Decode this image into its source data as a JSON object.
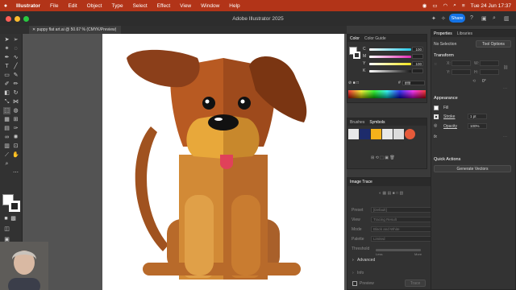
{
  "menubar": {
    "app_name": "Illustrator",
    "items": [
      "File",
      "Edit",
      "Object",
      "Type",
      "Select",
      "Effect",
      "View",
      "Window",
      "Help"
    ],
    "datetime": "Tue 24 Jun  17:37"
  },
  "window": {
    "title": "Adobe Illustrator 2025",
    "share_label": "Share"
  },
  "document_tab": {
    "label": "puppy flat art.ai @ 50.67 % (CMYK/Preview)"
  },
  "color_panel": {
    "tabs": [
      "Color",
      "Color Guide"
    ],
    "channels": [
      {
        "label": "C",
        "value": "100",
        "color": "#27c9e8"
      },
      {
        "label": "M",
        "value": "",
        "color": "#e32bb3"
      },
      {
        "label": "Y",
        "value": "100",
        "color": "#f1e51d"
      },
      {
        "label": "K",
        "value": "",
        "color": "#1a1a1a"
      }
    ],
    "hex": "ffffff"
  },
  "brushes_panel": {
    "tabs": [
      "Brushes",
      "Symbols"
    ]
  },
  "image_trace_panel": {
    "title": "Image Trace",
    "fields": [
      {
        "label": "Preset",
        "value": "[Default]"
      },
      {
        "label": "View",
        "value": "Tracing Result"
      },
      {
        "label": "Mode",
        "value": "Black and White"
      },
      {
        "label": "Palette",
        "value": "Limited"
      }
    ],
    "threshold_label": "Threshold",
    "threshold_less": "Less",
    "threshold_more": "More",
    "advanced_label": "Advanced",
    "info_label": "Info",
    "preview_label": "Preview",
    "trace_button": "Trace"
  },
  "properties_panel": {
    "tabs": [
      "Properties",
      "Libraries"
    ],
    "selection": "No Selection",
    "tool_options_button": "Tool Options",
    "transform_label": "Transform",
    "fields": [
      "X:",
      "Y:",
      "W:",
      "H:"
    ],
    "angle_value": "0°",
    "appearance_label": "Appearance",
    "fill_label": "Fill",
    "stroke_label": "Stroke",
    "stroke_value": "1 pt",
    "opacity_label": "Opacity",
    "opacity_value": "100%",
    "fx_label": "fx",
    "quick_actions_label": "Quick Actions",
    "generate_button": "Generate Vectors"
  },
  "dog_colors": {
    "ear": "#8b3f1a",
    "head": "#b85a22",
    "body_light": "#d28a36",
    "body_dark": "#b86a2a",
    "snout": "#e8a83a",
    "nose": "#111111",
    "tongue": "#e0415a"
  }
}
